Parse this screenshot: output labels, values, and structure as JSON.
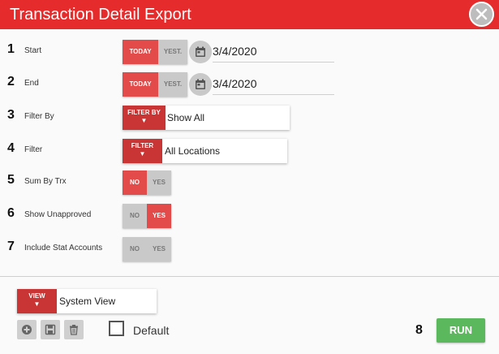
{
  "dialog": {
    "title": "Transaction Detail Export",
    "close_icon": "close-icon"
  },
  "rows": {
    "start": {
      "number": "1",
      "label": "Start",
      "opt_on": "TODAY",
      "opt_off": "YEST.",
      "date": "3/4/2020",
      "icon": "calendar-icon"
    },
    "end": {
      "number": "2",
      "label": "End",
      "opt_on": "TODAY",
      "opt_off": "YEST.",
      "date": "3/4/2020",
      "icon": "calendar-icon"
    },
    "filter_by": {
      "number": "3",
      "label": "Filter By",
      "button": "FILTER BY",
      "arrow": "▼",
      "value": "Show All"
    },
    "filter": {
      "number": "4",
      "label": "Filter",
      "button": "FILTER",
      "arrow": "▼",
      "value": "All Locations"
    },
    "sum_by_trx": {
      "number": "5",
      "label": "Sum By Trx",
      "no": "NO",
      "yes": "YES",
      "selected": "NO"
    },
    "show_unapproved": {
      "number": "6",
      "label": "Show Unapproved",
      "no": "NO",
      "yes": "YES",
      "selected": "YES"
    },
    "include_stat": {
      "number": "7",
      "label": "Include Stat Accounts",
      "no": "NO",
      "yes": "YES",
      "selected": "none"
    }
  },
  "footer": {
    "view_button": "VIEW",
    "view_arrow": "▼",
    "view_value": "System View",
    "icons": [
      "add-icon",
      "save-icon",
      "trash-icon"
    ],
    "default_label": "Default",
    "default_checked": false,
    "run_number": "8",
    "run_label": "RUN"
  },
  "colors": {
    "titlebar": "#e52b2b",
    "toggle_on": "#e34b4b",
    "toggle_off": "#c9c9c9",
    "dropdown_button": "#c93535",
    "run_button": "#5cb85c"
  }
}
